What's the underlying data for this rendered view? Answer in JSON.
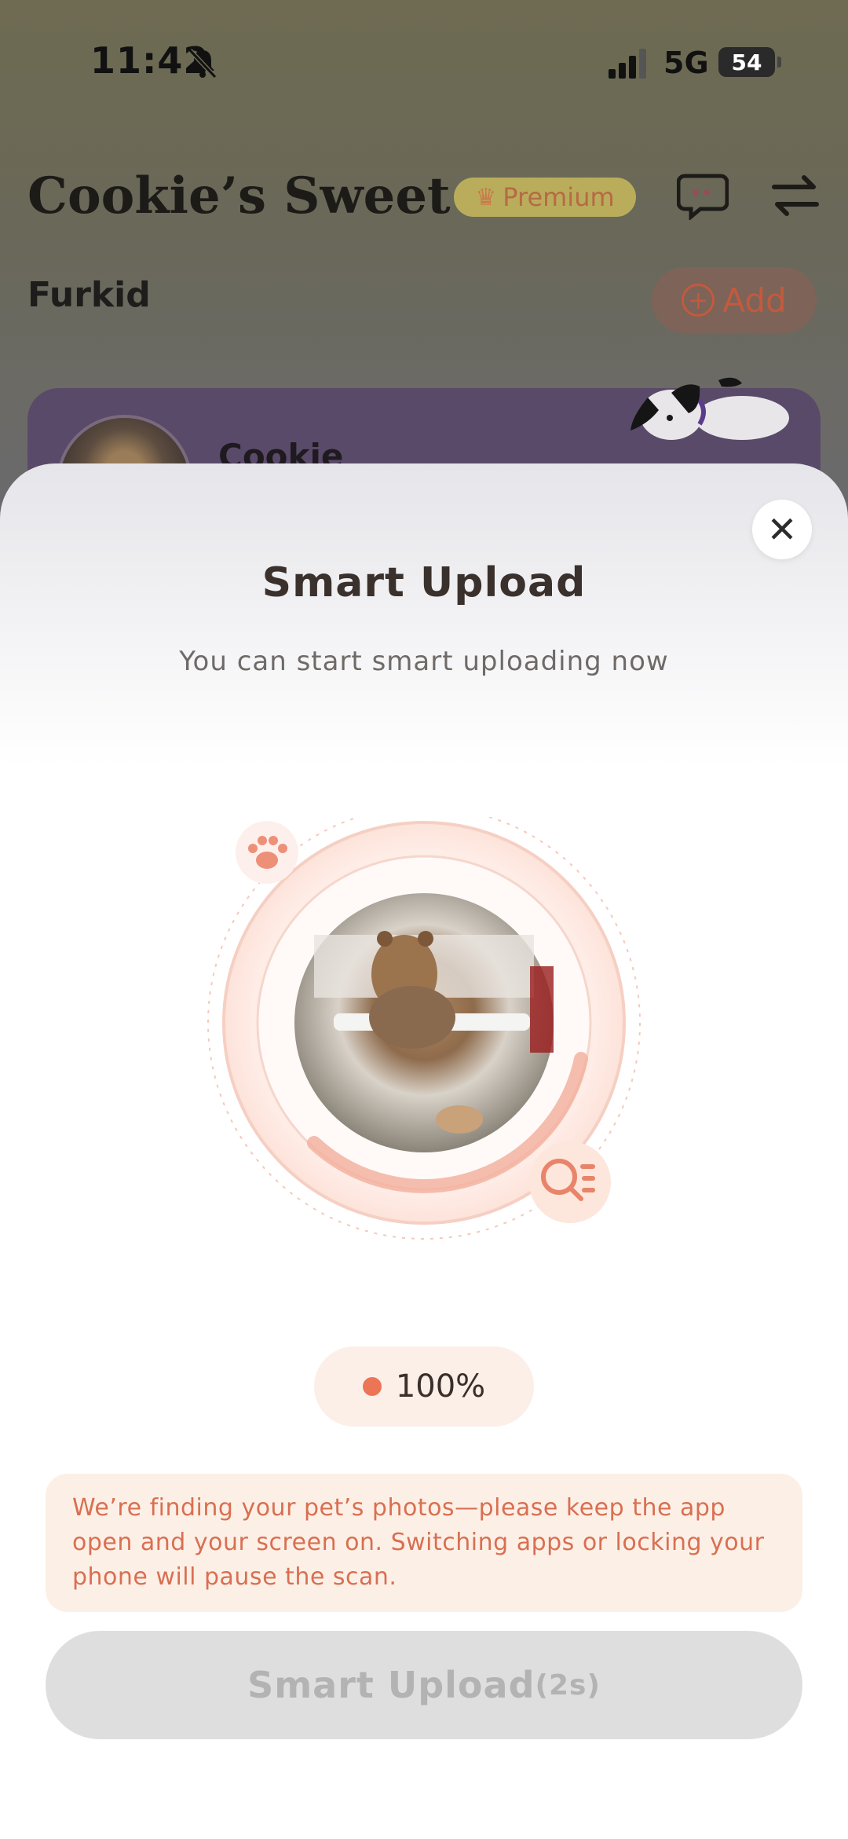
{
  "status_bar": {
    "time": "11:42",
    "network": "5G",
    "battery": "54",
    "icons": [
      "bell-muted-icon",
      "signal-icon"
    ]
  },
  "header": {
    "title": "Cookie’s Sweet ...",
    "premium_label": "Premium",
    "icons": [
      "crown-icon",
      "chat-icon",
      "switch-icon"
    ]
  },
  "section": {
    "label": "Furkid",
    "add_label": "Add"
  },
  "pet_card": {
    "name": "Cookie"
  },
  "sheet": {
    "title": "Smart Upload",
    "subtitle": "You can start smart uploading now",
    "progress": "100%",
    "progress_fraction": 1.0,
    "notice": "We’re finding your pet’s photos—please keep the app open and your screen on. Switching apps or locking your phone will pause the scan.",
    "button_label": "Smart Upload",
    "button_countdown": "(2s)"
  },
  "colors": {
    "accent": "#ec7556",
    "premium_bg": "#f1e26b",
    "card_purple": "#8a6cbf",
    "notice_bg": "#fcf0e6",
    "notice_text": "#d96f52",
    "disabled_button": "#dedede"
  }
}
